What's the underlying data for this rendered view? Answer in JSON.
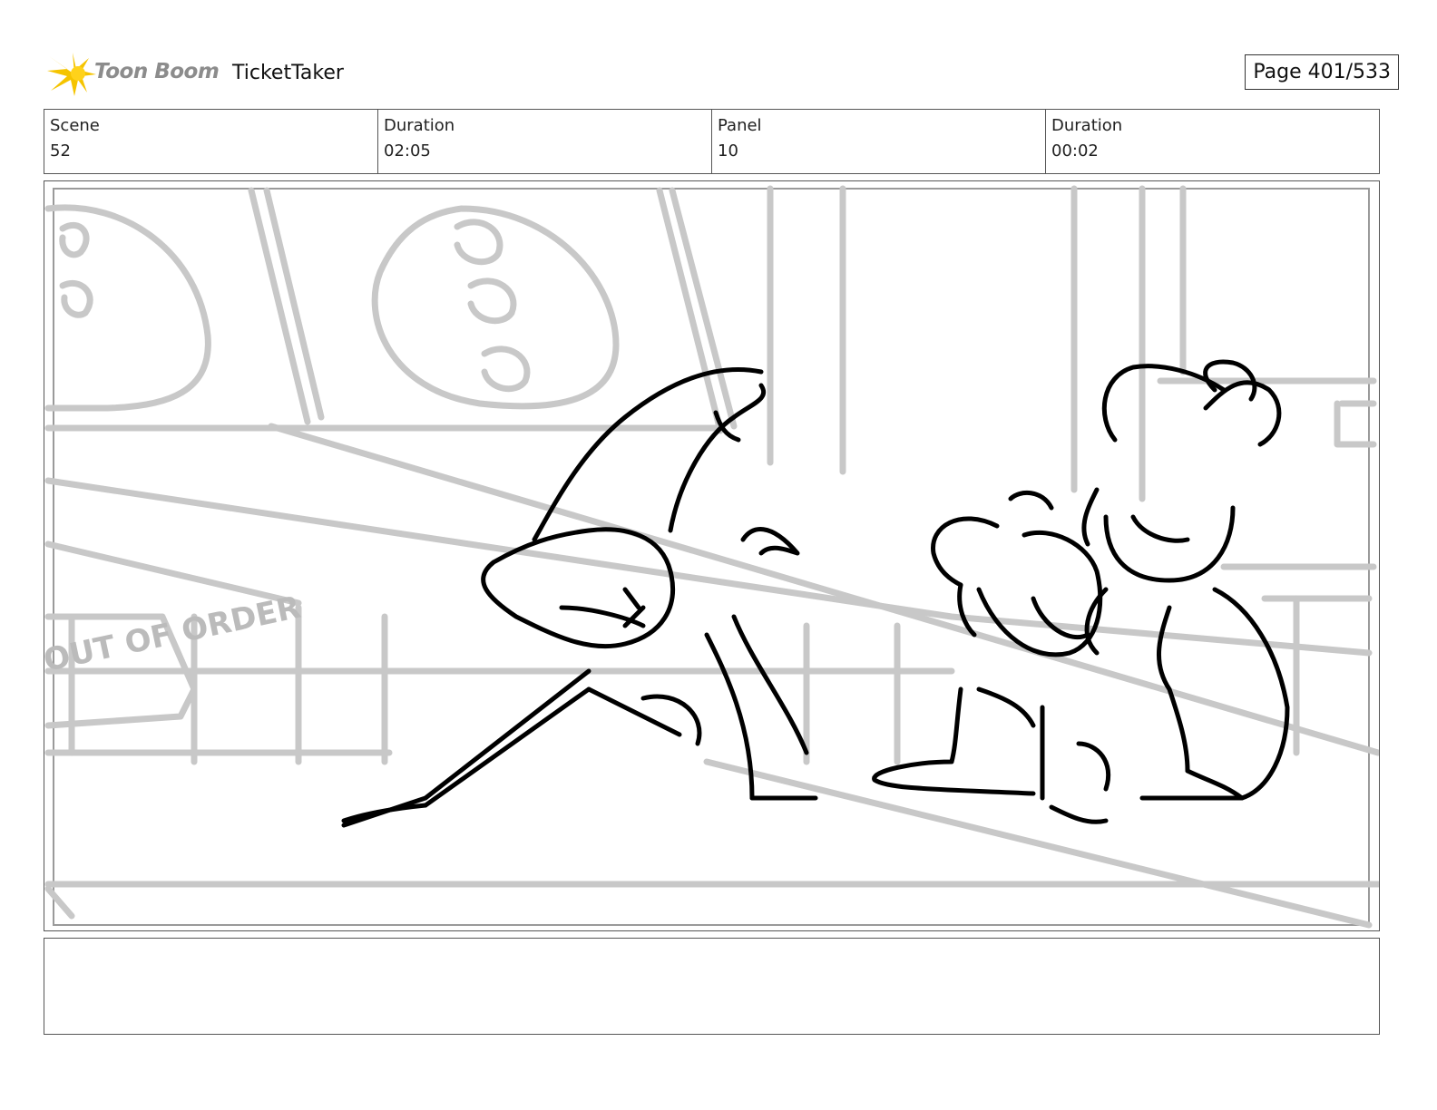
{
  "header": {
    "logo_text": "Toon Boom",
    "project_title": "TicketTaker",
    "page_label": "Page 401/533"
  },
  "info": {
    "scene_label": "Scene",
    "scene_value": "52",
    "scene_duration_label": "Duration",
    "scene_duration_value": "02:05",
    "panel_label": "Panel",
    "panel_value": "10",
    "panel_duration_label": "Duration",
    "panel_duration_value": "00:02"
  },
  "drawing": {
    "sign_text": "OUT OF ORDER"
  },
  "colors": {
    "logo_yellow": "#f5c400",
    "logo_text": "#8c8c8c",
    "sketch_gray": "#c8c8c8",
    "sketch_black": "#000000"
  }
}
